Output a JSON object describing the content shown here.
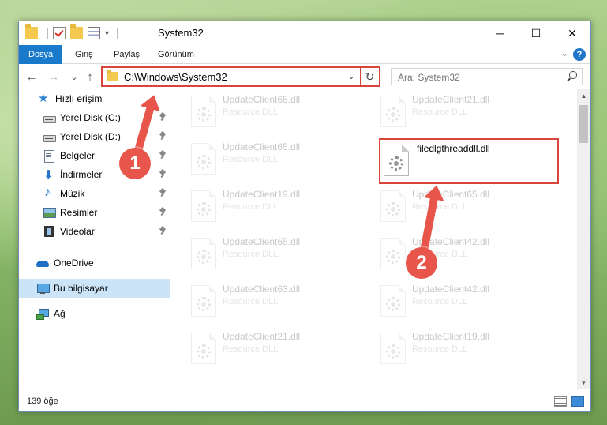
{
  "window": {
    "title": "System32",
    "minimize_glyph": "─",
    "maximize_glyph": "☐",
    "close_glyph": "✕"
  },
  "ribbon": {
    "tabs": [
      {
        "label": "Dosya",
        "active": true
      },
      {
        "label": "Giriş"
      },
      {
        "label": "Paylaş"
      },
      {
        "label": "Görünüm"
      }
    ],
    "help": "?",
    "collapse_glyph": "⌄"
  },
  "nav": {
    "back": "←",
    "forward": "→",
    "recent": "⌄",
    "up": "↑",
    "address": "C:\\Windows\\System32",
    "address_dropdown": "⌄",
    "refresh": "↻",
    "search_placeholder": "Ara: System32"
  },
  "sidebar": {
    "items": [
      {
        "label": "Hızlı erişim",
        "icon": "star-icon"
      },
      {
        "label": "Yerel Disk (C:)",
        "icon": "disk-icon",
        "pinned": true
      },
      {
        "label": "Yerel Disk (D:)",
        "icon": "disk-icon",
        "pinned": true
      },
      {
        "label": "Belgeler",
        "icon": "documents-icon",
        "pinned": true
      },
      {
        "label": "İndirmeler",
        "icon": "download-icon",
        "pinned": true
      },
      {
        "label": "Müzik",
        "icon": "music-icon",
        "pinned": true
      },
      {
        "label": "Resimler",
        "icon": "pictures-icon",
        "pinned": true
      },
      {
        "label": "Videolar",
        "icon": "videos-icon",
        "pinned": true
      },
      {
        "label": "OneDrive",
        "icon": "onedrive-icon"
      },
      {
        "label": "Bu bilgisayar",
        "icon": "this-pc-icon",
        "selected": true
      },
      {
        "label": "Ağ",
        "icon": "network-icon"
      }
    ]
  },
  "files": [
    {
      "name": "UpdateClient65.dll",
      "type": "Resource DLL"
    },
    {
      "name": "UpdateClient21.dll",
      "type": "Resource DLL"
    },
    {
      "name": "UpdateClient65.dll",
      "type": "Resource DLL"
    },
    {
      "name": "filedlgthreaddll.dll",
      "type": ""
    },
    {
      "name": "UpdateClient19.dll",
      "type": "Resource DLL"
    },
    {
      "name": "UpdateClient65.dll",
      "type": "Resource DLL"
    },
    {
      "name": "UpdateClient65.dll",
      "type": "Resource DLL"
    },
    {
      "name": "UpdateClient42.dll",
      "type": "Resource DLL"
    },
    {
      "name": "UpdateClient63.dll",
      "type": "Resource DLL"
    },
    {
      "name": "UpdateClient42.dll",
      "type": "Resource DLL"
    },
    {
      "name": "UpdateClient21.dll",
      "type": "Resource DLL"
    },
    {
      "name": "UpdateClient19.dll",
      "type": "Resource DLL"
    }
  ],
  "status": {
    "item_count": "139 öğe"
  },
  "annotations": {
    "step1": "1",
    "step2": "2",
    "color": "#e8554a"
  }
}
